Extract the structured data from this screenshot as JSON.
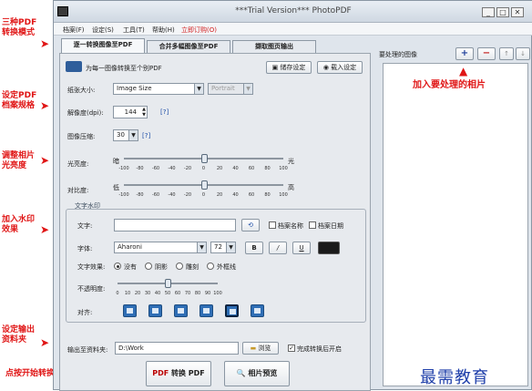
{
  "window": {
    "title": "***Trial Version*** PhotoPDF"
  },
  "menu": [
    "档案(F)",
    "设定(S)",
    "工具(T)",
    "帮助(H)",
    "立即订购(O)"
  ],
  "tabs": [
    "逐一转换图像至PDF",
    "合并多幅图像至PDF",
    "撷取图页输出"
  ],
  "header": {
    "desc": "为每一图像转换至个别PDF",
    "save": "储存设定",
    "load": "载入设定"
  },
  "paper": {
    "label": "纸张大小:",
    "value": "Image Size",
    "orientation": "Portrait"
  },
  "resolution": {
    "label": "解像度(dpi):",
    "value": "144",
    "help": "[?]"
  },
  "compression": {
    "label": "图像压缩:",
    "value": "30",
    "help": "[?]"
  },
  "brightness": {
    "label": "光亮度:",
    "left": "暗",
    "right": "光",
    "value": 0
  },
  "contrast": {
    "label": "对比度:",
    "left": "低",
    "right": "高",
    "value": 0
  },
  "bc_ticks": [
    "-100",
    "-80",
    "-60",
    "-40",
    "-20",
    "0",
    "20",
    "40",
    "60",
    "80",
    "100"
  ],
  "watermark": {
    "group": "文字水印",
    "text_label": "文字:",
    "text_value": "",
    "file_name": "档案名称",
    "file_date": "档案日期",
    "font_label": "字体:",
    "font": "Aharoni",
    "size": "72",
    "bold": "B",
    "italic": "/",
    "underline": "U",
    "color": "#1a1a1a",
    "effect_label": "文字效果:",
    "effects": [
      "没有",
      "阴影",
      "雕刻",
      "外框线"
    ],
    "opacity_label": "不透明度:",
    "opacity_value": 50,
    "opacity_ticks": [
      "0",
      "10",
      "20",
      "30",
      "40",
      "50",
      "60",
      "70",
      "80",
      "90",
      "100"
    ],
    "align_label": "对齐:"
  },
  "output": {
    "label": "输出至资料夹:",
    "path": "D:\\Work",
    "browse": "浏览",
    "open_after": "完成转换后开启"
  },
  "actions": {
    "convert": "转换 PDF",
    "preview": "相片预览"
  },
  "right": {
    "label": "要处理的图像"
  },
  "annotations": {
    "a1": "三种PDF\n转换模式",
    "a2": "设定PDF\n档案规格",
    "a3": "调整相片\n光亮度",
    "a4": "加入水印\n效果",
    "a5": "设定输出\n资料夹",
    "a6": "点按开始转换",
    "a7": "加入要处理的相片"
  },
  "watermark_logo": "最需教育"
}
